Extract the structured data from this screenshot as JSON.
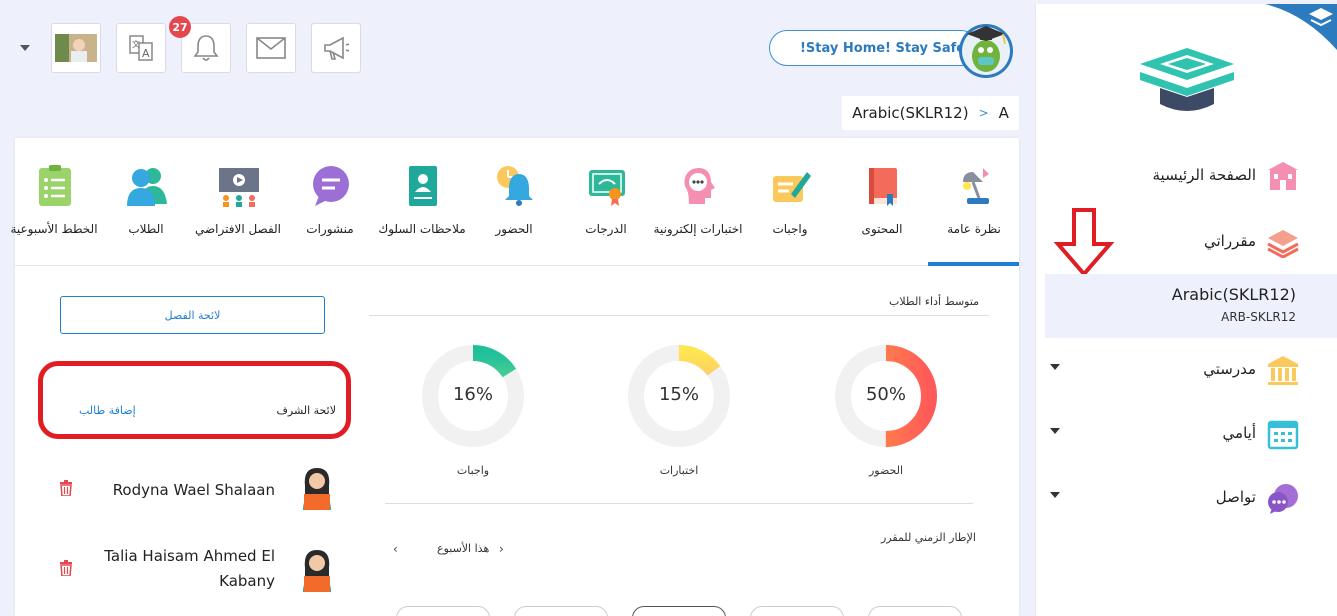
{
  "topbar": {
    "notification_count": "27",
    "stay_home_label": "!Stay Home! Stay Safe"
  },
  "breadcrumb": {
    "course": "Arabic(SKLR12)",
    "separator": ">",
    "section": "A"
  },
  "sidebar": {
    "items": [
      {
        "label": "الصفحة الرئيسية",
        "icon": "home-building-icon"
      },
      {
        "label": "مقرراتي",
        "icon": "books-icon"
      },
      {
        "label": "مدرستي",
        "icon": "school-icon"
      },
      {
        "label": "أيامي",
        "icon": "calendar-icon"
      },
      {
        "label": "تواصل",
        "icon": "chat-bubble-icon"
      }
    ],
    "active_course": {
      "name": "Arabic(SKLR12)",
      "code": "ARB-SKLR12"
    }
  },
  "tabs": [
    {
      "label": "نظرة عامة",
      "icon": "lamp-overview-icon"
    },
    {
      "label": "المحتوى",
      "icon": "book-content-icon"
    },
    {
      "label": "واجبات",
      "icon": "homework-pen-icon"
    },
    {
      "label": "اختبارات إلكترونية",
      "icon": "quiz-head-icon"
    },
    {
      "label": "الدرجات",
      "icon": "certificate-icon"
    },
    {
      "label": "الحضور",
      "icon": "attendance-bell-icon"
    },
    {
      "label": "ملاحظات السلوك",
      "icon": "behavior-notes-icon"
    },
    {
      "label": "منشورات",
      "icon": "posts-chat-icon"
    },
    {
      "label": "الفصل الافتراضي",
      "icon": "virtual-class-icon"
    },
    {
      "label": "الطلاب",
      "icon": "students-icon"
    },
    {
      "label": "الخطط الأسبوعية",
      "icon": "weekly-plan-icon"
    }
  ],
  "performance": {
    "title": "متوسط أداء الطلاب",
    "metrics": [
      {
        "label": "الحضور",
        "value": "50%",
        "fraction": 0.5,
        "color_start": "#ff5a5a",
        "color_end": "#ff9a3c"
      },
      {
        "label": "اختبارات",
        "value": "15%",
        "fraction": 0.15,
        "color_start": "#f48fb1",
        "color_end": "#ffe54f"
      },
      {
        "label": "واجبات",
        "value": "16%",
        "fraction": 0.16,
        "color_start": "#b7f08a",
        "color_end": "#1fbf9a"
      }
    ]
  },
  "timeline": {
    "title": "الإطار الزمني للمقرر",
    "week_label": "هذا الأسبوع"
  },
  "class_panel": {
    "class_list_label": "لائحة الفصل",
    "honor_list_label": "لائحة الشرف",
    "add_student_label": "إضافة طالب",
    "students": [
      {
        "name": "Rodyna Wael Shalaan"
      },
      {
        "name": "Talia Haisam Ahmed El Kabany"
      }
    ]
  }
}
